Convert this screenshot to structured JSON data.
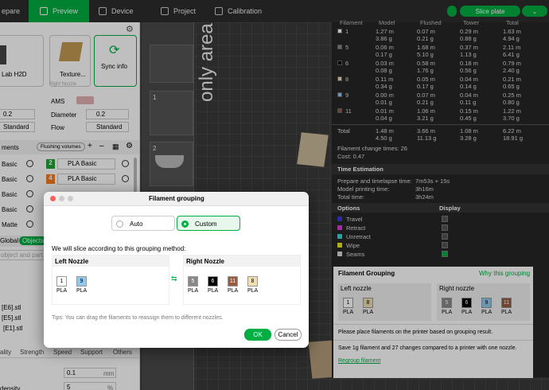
{
  "topbar": {
    "prepare": "epare",
    "preview": "Preview",
    "device": "Device",
    "project": "Project",
    "calibration": "Calibration",
    "slice_plate": "Slice plate"
  },
  "sidebar": {
    "printer": "Lab H2D",
    "plate": "Texture...",
    "sync": "Sync info",
    "right_nozzle": "Right Nozzle",
    "nozzle_val": "0.2",
    "ams": "AMS",
    "diameter_label": "Diameter",
    "diameter_val": "0.2",
    "standard1": "Standard",
    "flow_label": "Flow",
    "standard2": "Standard",
    "filaments_label": "ments",
    "flushing": "Flushing volumes",
    "rows": [
      {
        "name": "Basic",
        "num": "2",
        "mat": "PLA Basic",
        "color": "#21a336"
      },
      {
        "name": "Basic",
        "num": "4",
        "mat": "PLA Basic",
        "color": "#f57c1f"
      },
      {
        "name": "Basic"
      },
      {
        "name": "Basic"
      },
      {
        "name": "Matte"
      }
    ],
    "global": "Global",
    "objects": "Objects",
    "search_ph": "object and part...",
    "files": [
      "[E6].stl",
      "[E5].stl",
      "[E1].stl"
    ],
    "tabs": [
      "ality",
      "Strength",
      "Speed",
      "Support",
      "Others"
    ],
    "val1": "0.1",
    "unit1": "mm",
    "density_label": "density",
    "val2": "5",
    "unit2": "%"
  },
  "viewport": {
    "only_area": "only area",
    "thumb1": "1",
    "thumb2": "2"
  },
  "stats": {
    "headers": [
      "Filament",
      "Model",
      "Flushed",
      "Tower",
      "Total"
    ],
    "rows": [
      {
        "id": "1",
        "color": "#ffffff",
        "model": [
          "1.27 m",
          "3.86 g"
        ],
        "flushed": [
          "0.07 m",
          "0.21 g"
        ],
        "tower": [
          "0.29 m",
          "0.88 g"
        ],
        "total": [
          "1.63 m",
          "4.94 g"
        ]
      },
      {
        "id": "5",
        "color": "#888888",
        "model": [
          "0.06 m",
          "0.17 g"
        ],
        "flushed": [
          "1.68 m",
          "5.10 g"
        ],
        "tower": [
          "0.37 m",
          "1.13 g"
        ],
        "total": [
          "2.11 m",
          "6.41 g"
        ]
      },
      {
        "id": "6",
        "color": "#000000",
        "model": [
          "0.03 m",
          "0.08 g"
        ],
        "flushed": [
          "0.58 m",
          "1.76 g"
        ],
        "tower": [
          "0.18 m",
          "0.56 g"
        ],
        "total": [
          "0.79 m",
          "2.40 g"
        ]
      },
      {
        "id": "8",
        "color": "#f0dfb0",
        "model": [
          "0.11 m",
          "0.34 g"
        ],
        "flushed": [
          "0.05 m",
          "0.17 g"
        ],
        "tower": [
          "0.04 m",
          "0.14 g"
        ],
        "total": [
          "0.21 m",
          "0.65 g"
        ]
      },
      {
        "id": "9",
        "color": "#8fc8f0",
        "model": [
          "0.00 m",
          "0.01 g"
        ],
        "flushed": [
          "0.07 m",
          "0.21 g"
        ],
        "tower": [
          "0.04 m",
          "0.11 g"
        ],
        "total": [
          "0.25 m",
          "0.80 g"
        ]
      },
      {
        "id": "11",
        "color": "#9a5a3c",
        "model": [
          "0.01 m",
          "0.04 g"
        ],
        "flushed": [
          "1.06 m",
          "3.21 g"
        ],
        "tower": [
          "0.15 m",
          "0.45 g"
        ],
        "total": [
          "1.22 m",
          "3.70 g"
        ]
      }
    ],
    "total_label": "Total",
    "total_model": [
      "1.48 m",
      "4.50 g"
    ],
    "total_flushed": [
      "3.66 m",
      "11.13 g"
    ],
    "total_tower": [
      "1.08 m",
      "3.28 g"
    ],
    "total_total": [
      "6.22 m",
      "18.91 g"
    ],
    "change_times": "Filament change times:  26",
    "cost": "Cost:  0.47",
    "time_title": "Time Estimation",
    "prep_label": "Prepare and timelapse time:",
    "prep_val": "7m53s + 15s",
    "model_time_label": "Model printing time:",
    "model_time_val": "3h16m",
    "total_time_label": "Total time:",
    "total_time_val": "3h24m",
    "options_label": "Options",
    "display_label": "Display",
    "options": [
      {
        "label": "Travel",
        "color": "#3b3bd6"
      },
      {
        "label": "Retract",
        "color": "#d63bd6"
      },
      {
        "label": "Unretract",
        "color": "#3bd6d6"
      },
      {
        "label": "Wipe",
        "color": "#e8e820"
      },
      {
        "label": "Seams",
        "color": "#d8d8d8"
      }
    ]
  },
  "grouping": {
    "title": "Filament Grouping",
    "why": "Why this grouping",
    "left": "Left nozzle",
    "right": "Right nozzle",
    "left_items": [
      {
        "id": "1",
        "mat": "PLA",
        "color": "#ffffff"
      },
      {
        "id": "8",
        "mat": "PLA",
        "color": "#f0dfb0"
      }
    ],
    "right_items": [
      {
        "id": "5",
        "mat": "PLA",
        "color": "#888888"
      },
      {
        "id": "6",
        "mat": "PLA",
        "color": "#000000"
      },
      {
        "id": "9",
        "mat": "PLA",
        "color": "#8fc8f0"
      },
      {
        "id": "11",
        "mat": "PLA",
        "color": "#9a5a3c"
      }
    ],
    "note1": "Please place filaments on the printer based on grouping result.",
    "note2": "Save 1g filament and 27 changes compared to a printer with one nozzle.",
    "regroup": "Regroup filament"
  },
  "dialog": {
    "title": "Filament grouping",
    "auto": "Auto",
    "custom": "Custom",
    "desc": "We will slice according to this grouping method:",
    "left": "Left Nozzle",
    "right": "Right Nozzle",
    "left_items": [
      {
        "id": "1",
        "mat": "PLA",
        "color": "#ffffff"
      },
      {
        "id": "9",
        "mat": "PLA",
        "color": "#8fc8f0"
      }
    ],
    "right_items": [
      {
        "id": "5",
        "mat": "PLA",
        "color": "#888888"
      },
      {
        "id": "6",
        "mat": "PLA",
        "color": "#000000"
      },
      {
        "id": "11",
        "mat": "PLA",
        "color": "#9a5a3c"
      },
      {
        "id": "8",
        "mat": "PLA",
        "color": "#f0dfb0"
      }
    ],
    "tips": "Tips: You can drag the filaments to reassign them to different nozzles.",
    "ok": "OK",
    "cancel": "Cancel"
  }
}
